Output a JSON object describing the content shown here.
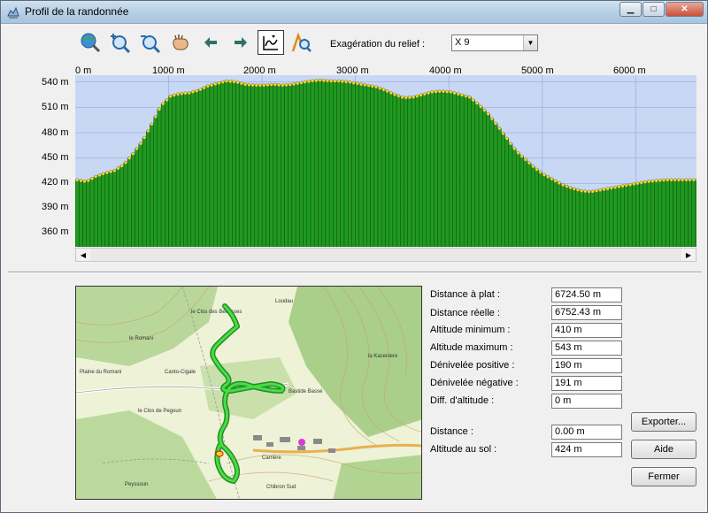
{
  "window": {
    "title": "Profil de la randonnée",
    "minimize_label": "▁",
    "maximize_label": "□",
    "close_label": "✕"
  },
  "toolbar": {
    "tools": [
      {
        "icon": "globe-zoom-icon"
      },
      {
        "icon": "zoom-in-icon"
      },
      {
        "icon": "zoom-out-icon"
      },
      {
        "icon": "pan-hand-icon"
      },
      {
        "icon": "arrow-left-icon"
      },
      {
        "icon": "arrow-right-icon"
      },
      {
        "icon": "profile-select-icon",
        "active": true
      },
      {
        "icon": "route-zoom-icon"
      }
    ],
    "relief_label": "Exagération du relief :",
    "relief_value": "X 9"
  },
  "chart_data": {
    "type": "area",
    "x_tick_labels": [
      "0 m",
      "1000 m",
      "2000 m",
      "3000 m",
      "4000 m",
      "5000 m",
      "6000 m"
    ],
    "y_tick_labels": [
      "540 m",
      "510 m",
      "480 m",
      "450 m",
      "420 m",
      "390 m",
      "360 m"
    ],
    "xlim": [
      0,
      6650
    ],
    "ylim": [
      345,
      548
    ],
    "x": [
      0,
      100,
      200,
      300,
      400,
      500,
      600,
      700,
      800,
      900,
      1000,
      1100,
      1200,
      1300,
      1400,
      1500,
      1600,
      1700,
      1800,
      1900,
      2000,
      2100,
      2200,
      2300,
      2400,
      2500,
      2600,
      2700,
      2800,
      2900,
      3000,
      3100,
      3200,
      3300,
      3400,
      3500,
      3600,
      3700,
      3800,
      3900,
      4000,
      4100,
      4200,
      4300,
      4400,
      4500,
      4600,
      4700,
      4800,
      4900,
      5000,
      5100,
      5200,
      5300,
      5400,
      5500,
      5600,
      5700,
      5800,
      5900,
      6000,
      6100,
      6200,
      6300,
      6400,
      6500,
      6600,
      6650
    ],
    "y": [
      424,
      422,
      428,
      432,
      435,
      442,
      455,
      470,
      490,
      512,
      523,
      526,
      527,
      530,
      535,
      538,
      541,
      540,
      537,
      536,
      536,
      537,
      536,
      537,
      539,
      541,
      542,
      541,
      541,
      540,
      538,
      536,
      534,
      530,
      525,
      521,
      522,
      525,
      528,
      529,
      528,
      525,
      522,
      513,
      502,
      488,
      473,
      458,
      448,
      438,
      430,
      424,
      418,
      414,
      411,
      410,
      412,
      414,
      416,
      418,
      420,
      422,
      423,
      424,
      424,
      424,
      424,
      424
    ],
    "grid": true
  },
  "stats": {
    "rows": [
      {
        "label": "Distance à plat :",
        "value": "6724.50 m"
      },
      {
        "label": "Distance réelle :",
        "value": "6752.43 m"
      },
      {
        "label": "Altitude minimum :",
        "value": "410 m"
      },
      {
        "label": "Altitude maximum :",
        "value": "543 m"
      },
      {
        "label": "Dénivelée positive :",
        "value": "190 m"
      },
      {
        "label": "Dénivelée négative :",
        "value": "191 m"
      },
      {
        "label": "Diff. d'altitude :",
        "value": "0 m"
      },
      {
        "label": "Distance :",
        "value": "0.00 m"
      },
      {
        "label": "Altitude au sol :",
        "value": "424 m"
      }
    ]
  },
  "buttons": {
    "export": "Exporter...",
    "help": "Aide",
    "close": "Fermer"
  },
  "map": {
    "labels": [
      {
        "text": "le Clos des Bécasses"
      },
      {
        "text": "le Romani"
      },
      {
        "text": "Plaine du Romani"
      },
      {
        "text": "Canto-Cigale"
      },
      {
        "text": "le Clos de Pegoun"
      },
      {
        "text": "Bastide Basse"
      },
      {
        "text": "Loudau"
      },
      {
        "text": "la Kaceniere"
      },
      {
        "text": "Chibron Sud"
      },
      {
        "text": "Carrière"
      },
      {
        "text": "Peyssoun"
      }
    ]
  },
  "colors": {
    "sky": "#c8d8f4",
    "ground": "#1f9a1f",
    "point": "#f0e020",
    "route": "#3ddc3d"
  }
}
